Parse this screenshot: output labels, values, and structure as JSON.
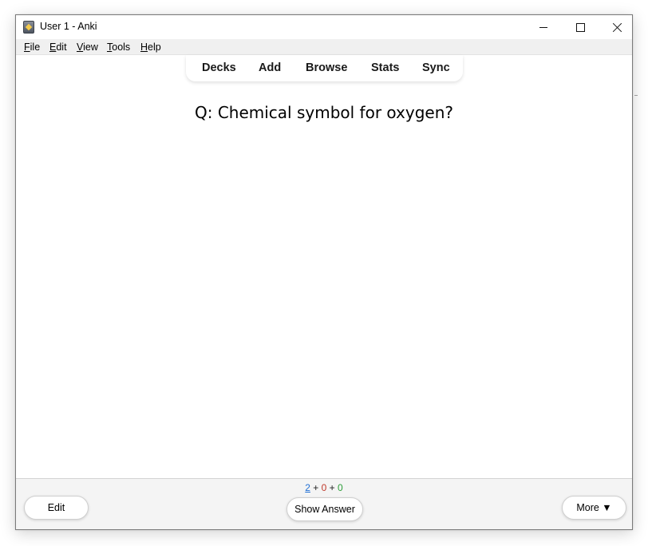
{
  "window": {
    "title": "User 1 - Anki",
    "icon": "anki-icon"
  },
  "menu": {
    "items": [
      {
        "mnemonic": "F",
        "rest": "ile"
      },
      {
        "mnemonic": "E",
        "rest": "dit"
      },
      {
        "mnemonic": "V",
        "rest": "iew"
      },
      {
        "mnemonic": "T",
        "rest": "ools"
      },
      {
        "mnemonic": "H",
        "rest": "elp"
      }
    ]
  },
  "toolbar": {
    "decks": "Decks",
    "add": "Add",
    "browse": "Browse",
    "stats": "Stats",
    "sync": "Sync"
  },
  "card": {
    "question": "Q: Chemical symbol for oxygen?"
  },
  "bottom": {
    "counts": {
      "new": "2",
      "sep1": " + ",
      "learning": "0",
      "sep2": " + ",
      "review": "0"
    },
    "edit_label": "Edit",
    "show_answer_label": "Show Answer",
    "more_label": "More ▼"
  },
  "colors": {
    "new_count": "#1f6ed4",
    "learning_count": "#c0392b",
    "review_count": "#2e9e3a"
  }
}
